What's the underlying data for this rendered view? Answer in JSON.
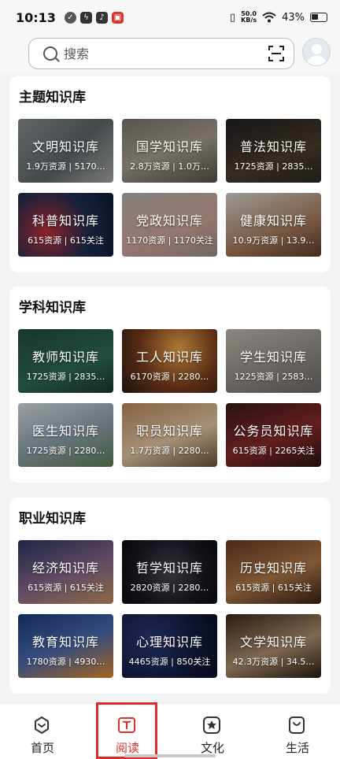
{
  "status": {
    "time": "10:13",
    "net_speed_value": "50.0",
    "net_speed_unit": "KB/s",
    "battery": "43%"
  },
  "search": {
    "placeholder": "搜索"
  },
  "sections": [
    {
      "title": "主题知识库",
      "tiles": [
        {
          "name": "文明知识库",
          "stats": "1.9万资源 | 5170…"
        },
        {
          "name": "国学知识库",
          "stats": "2.8万资源 | 1.0万…"
        },
        {
          "name": "普法知识库",
          "stats": "1725资源 | 2835…"
        },
        {
          "name": "科普知识库",
          "stats": "615资源 | 615关注"
        },
        {
          "name": "党政知识库",
          "stats": "1170资源 | 1170关注"
        },
        {
          "name": "健康知识库",
          "stats": "10.9万资源 | 13.9…"
        }
      ]
    },
    {
      "title": "学科知识库",
      "tiles": [
        {
          "name": "教师知识库",
          "stats": "1725资源 | 2835…"
        },
        {
          "name": "工人知识库",
          "stats": "6170资源 | 2280…"
        },
        {
          "name": "学生知识库",
          "stats": "1225资源 | 2583…"
        },
        {
          "name": "医生知识库",
          "stats": "1725资源 | 2280…"
        },
        {
          "name": "职员知识库",
          "stats": "1.7万资源 | 2280…"
        },
        {
          "name": "公务员知识库",
          "stats": "615资源 | 2265关注"
        }
      ]
    },
    {
      "title": "职业知识库",
      "tiles": [
        {
          "name": "经济知识库",
          "stats": "615资源 | 615关注"
        },
        {
          "name": "哲学知识库",
          "stats": "2820资源 | 2280…"
        },
        {
          "name": "历史知识库",
          "stats": "615资源 | 615关注"
        },
        {
          "name": "教育知识库",
          "stats": "1780资源 | 4930…"
        },
        {
          "name": "心理知识库",
          "stats": "4465资源 | 850关注"
        },
        {
          "name": "文学知识库",
          "stats": "42.3万资源 | 34.5…"
        }
      ]
    }
  ],
  "nav": [
    {
      "label": "首页",
      "icon": "home-icon"
    },
    {
      "label": "阅读",
      "icon": "book-icon"
    },
    {
      "label": "文化",
      "icon": "star-icon"
    },
    {
      "label": "生活",
      "icon": "bag-icon"
    }
  ],
  "colors": {
    "accent": "#d9342b",
    "highlight_box": "#e0292b",
    "background": "#f2f3f5"
  }
}
